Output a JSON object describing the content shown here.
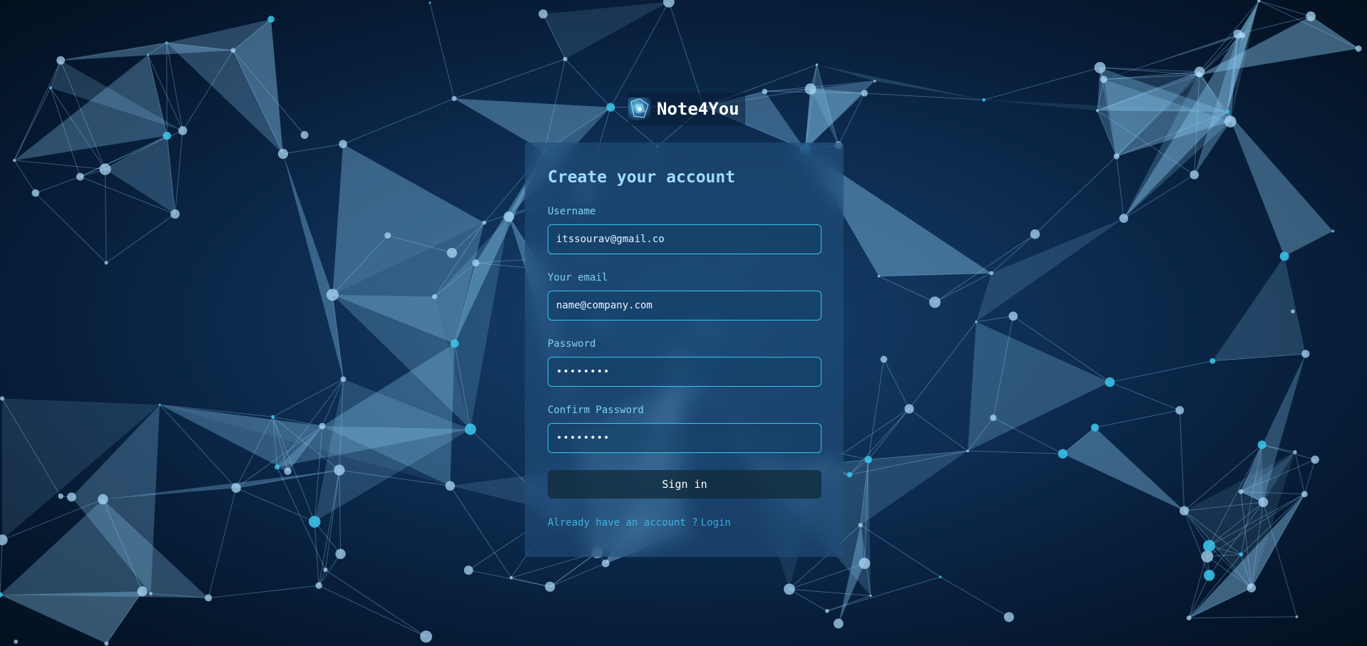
{
  "brand": {
    "name": "Note4You"
  },
  "form": {
    "title": "Create your account",
    "username": {
      "label": "Username",
      "value": "itssourav@gmail.co"
    },
    "email": {
      "label": "Your email",
      "value": "name@company.com"
    },
    "password": {
      "label": "Password",
      "value": "••••••••"
    },
    "confirm_password": {
      "label": "Confirm Password",
      "value": "••••••••"
    },
    "submit_label": "Sign in",
    "footer": {
      "text": "Already have an account ?",
      "link_label": "Login"
    }
  },
  "colors": {
    "background": "#0c2a4d",
    "accent": "#36c6ee",
    "title": "#9fdcff",
    "label": "#7fd0f2"
  }
}
